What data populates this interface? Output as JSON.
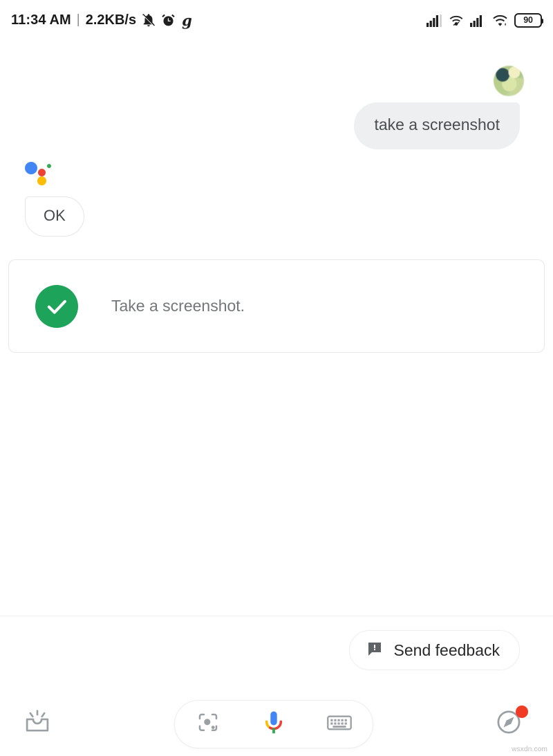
{
  "status_bar": {
    "clock": "11:34 AM",
    "separator": "|",
    "network_speed": "2.2KB/s",
    "left_icons": [
      "bell-mute-icon",
      "alarm-clock-icon",
      "google-g-icon"
    ],
    "right_icons": [
      "signal-bars-icon",
      "wifi-calling-icon",
      "signal-bars-2-icon",
      "wifi-icon"
    ],
    "battery_level": "90"
  },
  "conversation": {
    "user_message": {
      "text": "take a screenshot",
      "avatar": "user-avatar-photo"
    },
    "assistant_reply": {
      "logo": "google-assistant-logo",
      "text": "OK"
    },
    "result_card": {
      "icon": "green-check-icon",
      "text": "Take a screenshot.",
      "icon_color": "#1ea35a"
    }
  },
  "footer": {
    "send_feedback_label": "Send feedback",
    "send_feedback_icon": "feedback-bubble-icon"
  },
  "bottom_bar": {
    "snapshot_icon": "snapshot-inbox-icon",
    "lens_icon": "google-lens-icon",
    "mic_icon": "google-mic-icon",
    "keyboard_icon": "keyboard-icon",
    "explore_icon": "explore-compass-icon",
    "notification_dot_color": "#f03b25"
  },
  "watermark": "wsxdn.com",
  "colors": {
    "google_blue": "#4285f4",
    "google_red": "#ea4335",
    "google_yellow": "#fbbc05",
    "google_green": "#34a853",
    "user_bubble_bg": "#edeff0",
    "page_bg": "#ffffff"
  }
}
